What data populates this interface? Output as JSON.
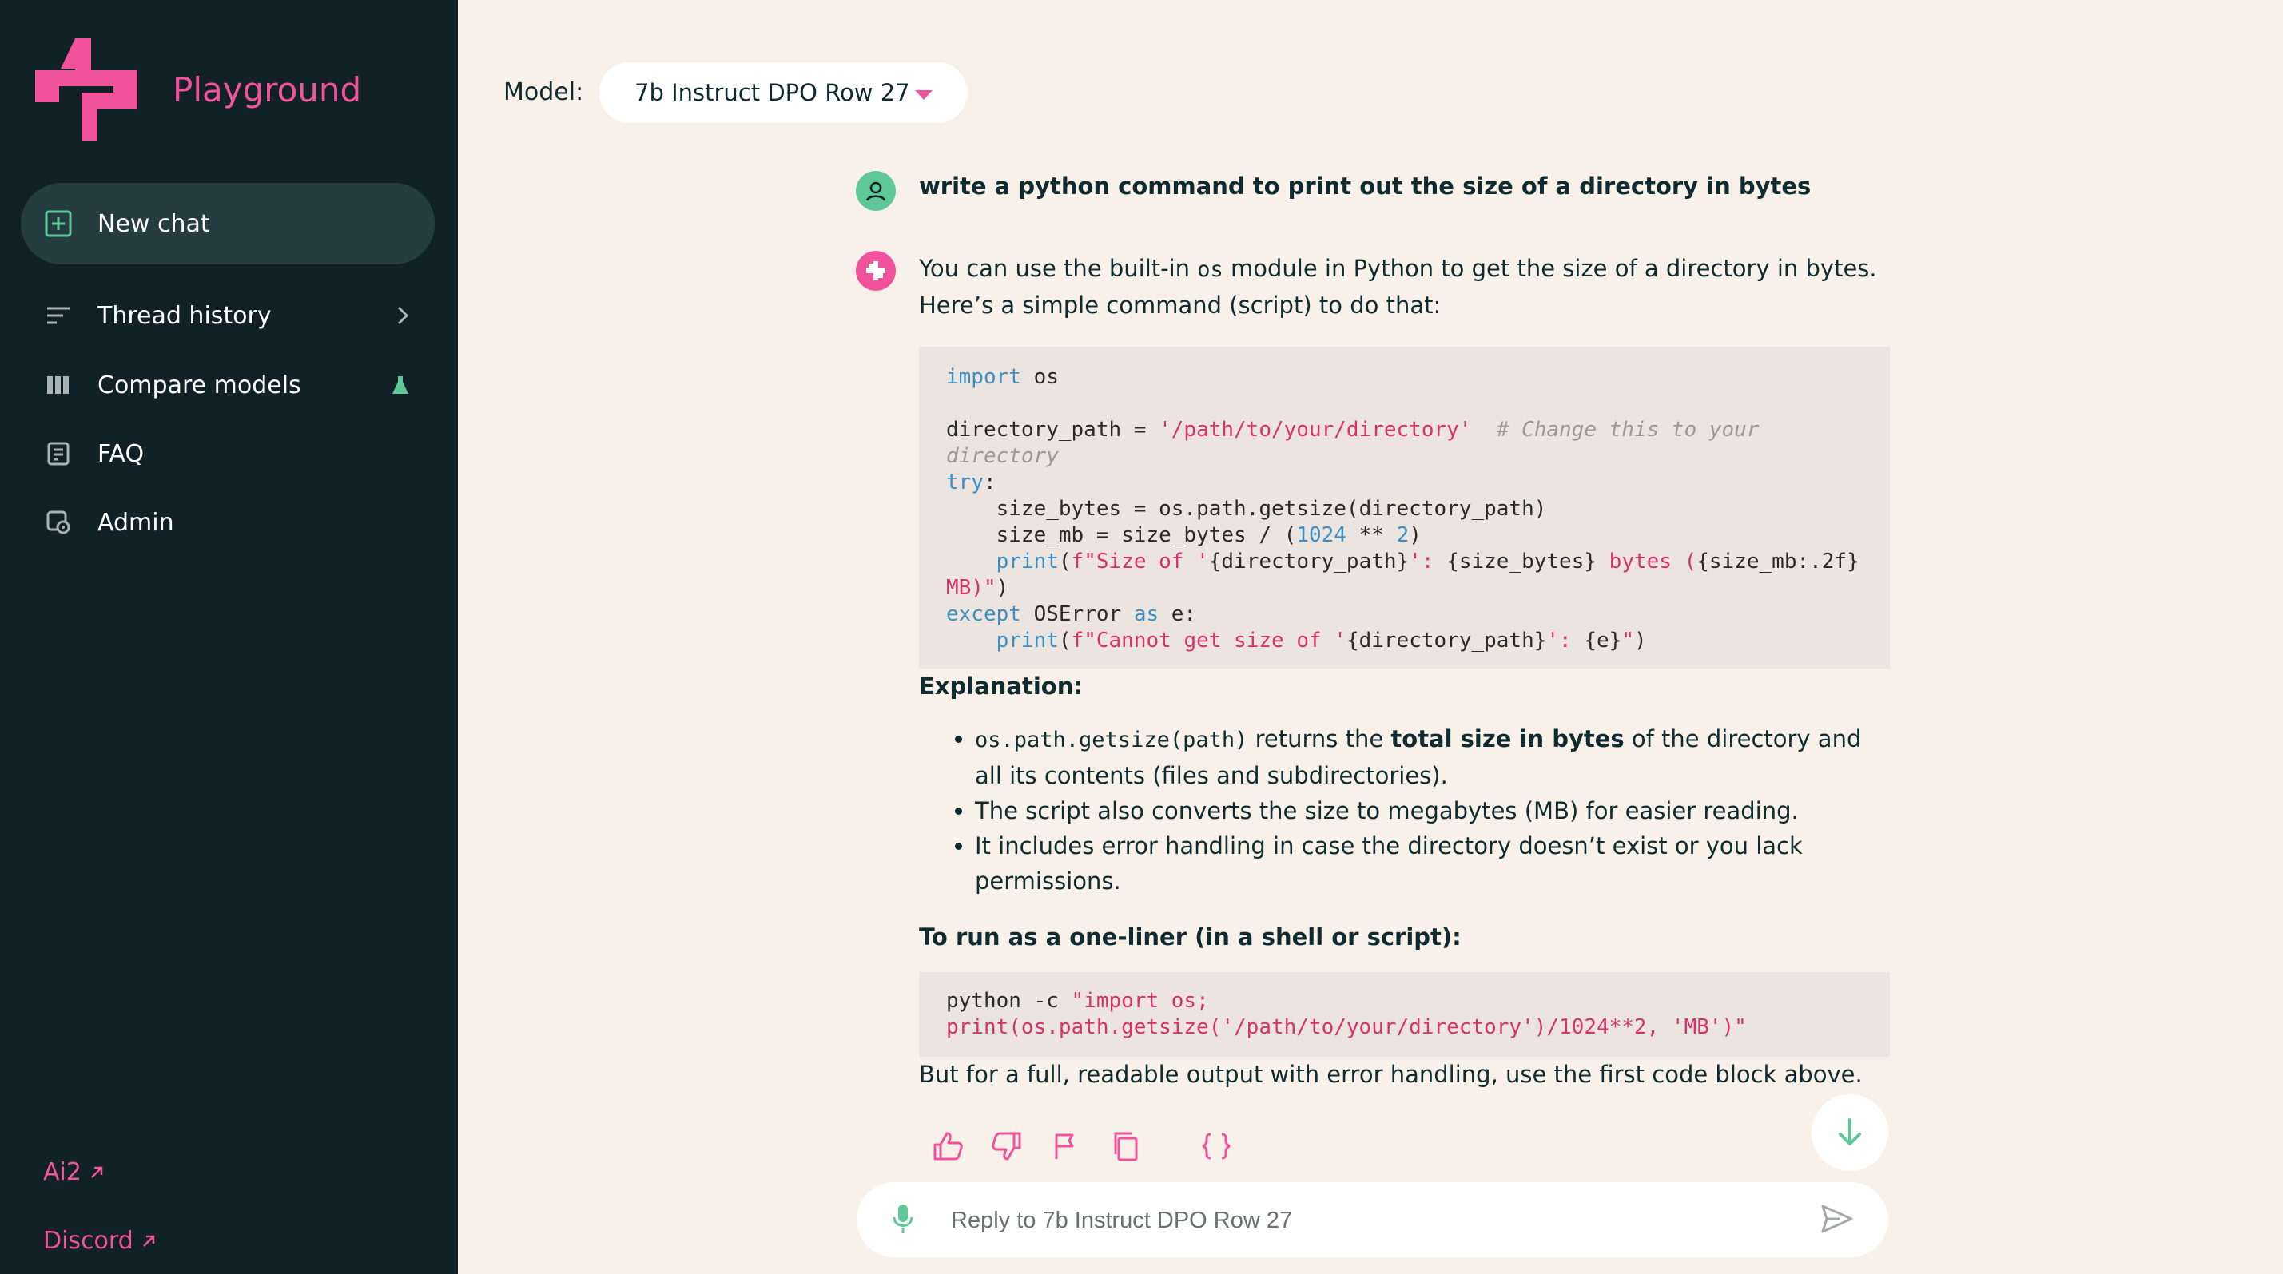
{
  "app": {
    "name": "Playground",
    "brand_color": "#f0529c",
    "sidebar_bg": "#102227",
    "accent_green": "#5fc897"
  },
  "sidebar": {
    "new_chat": {
      "label": "New chat",
      "icon": "plus-square-icon"
    },
    "items": [
      {
        "label": "Thread history",
        "icon": "lines-icon",
        "trail_icon": "chevron-right-icon"
      },
      {
        "label": "Compare models",
        "icon": "columns-icon",
        "trail_icon": "flask-icon"
      },
      {
        "label": "FAQ",
        "icon": "document-icon"
      },
      {
        "label": "Admin",
        "icon": "admin-gear-icon"
      }
    ],
    "footer_links": [
      {
        "label": "Ai2",
        "icon": "external-arrow-icon"
      },
      {
        "label": "Discord",
        "icon": "external-arrow-icon"
      }
    ]
  },
  "header": {
    "model_label": "Model:",
    "model_value": "7b Instruct DPO Row 27"
  },
  "chat": {
    "user_message": "write a python command to print out the size of a directory in bytes",
    "assistant": {
      "intro_before": "You can use the built-in ",
      "intro_code": "os",
      "intro_after": " module in Python to get the size of a directory in bytes. Here’s a simple command (script) to do that:",
      "code_block_1": [
        "import os",
        "",
        "directory_path = '/path/to/your/directory'  # Change this to your directory",
        "try:",
        "    size_bytes = os.path.getsize(directory_path)",
        "    size_mb = size_bytes / (1024 ** 2)",
        "    print(f\"Size of '{directory_path}': {size_bytes} bytes ({size_mb:.2f} MB)\")",
        "except OSError as e:",
        "    print(f\"Cannot get size of '{directory_path}': {e}\")"
      ],
      "explanation_heading": "Explanation:",
      "bullet_1_code": "os.path.getsize(path)",
      "bullet_1_mid": " returns the ",
      "bullet_1_bold": "total size in bytes",
      "bullet_1_end": " of the directory and all its contents (files and subdirectories).",
      "bullet_2": "The script also converts the size to megabytes (MB) for easier reading.",
      "bullet_3": "It includes error handling in case the directory doesn’t exist or you lack permissions.",
      "oneliner_heading": "To run as a one-liner (in a shell or script):",
      "code_block_2_cmd": "python -c ",
      "code_block_2_str": "\"import os; print(os.path.getsize('/path/to/your/directory')/1024**2, 'MB')\"",
      "closing": "But for a full, readable output with error handling, use the first code block above."
    },
    "actions": [
      "thumbs-up-icon",
      "thumbs-down-icon",
      "flag-icon",
      "copy-icon",
      "braces-icon"
    ]
  },
  "composer": {
    "placeholder": "Reply to 7b Instruct DPO Row 27",
    "value": ""
  }
}
